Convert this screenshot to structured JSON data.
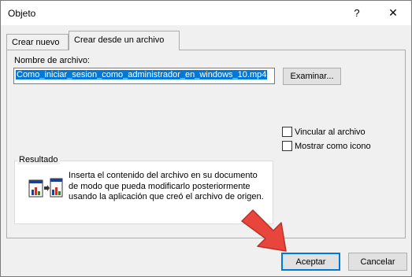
{
  "window": {
    "title": "Objeto",
    "help_glyph": "?",
    "close_glyph": "✕"
  },
  "tabs": [
    {
      "label": "Crear nuevo",
      "active": false
    },
    {
      "label": "Crear desde un archivo",
      "active": true
    }
  ],
  "file": {
    "label": "Nombre de archivo:",
    "value": "Como_iniciar_sesion_como_administrador_en_windows_10.mp4",
    "browse_label": "Examinar..."
  },
  "options": [
    {
      "label": "Vincular al archivo",
      "checked": false
    },
    {
      "label": "Mostrar como icono",
      "checked": false
    }
  ],
  "result": {
    "title": "Resultado",
    "text": "Inserta el contenido del archivo en su documento de modo que pueda modificarlo posteriormente usando la aplicación que creó el archivo de origen."
  },
  "buttons": {
    "ok": "Aceptar",
    "cancel": "Cancelar"
  },
  "colors": {
    "accent": "#0078d7",
    "arrow": "#e8453c"
  }
}
